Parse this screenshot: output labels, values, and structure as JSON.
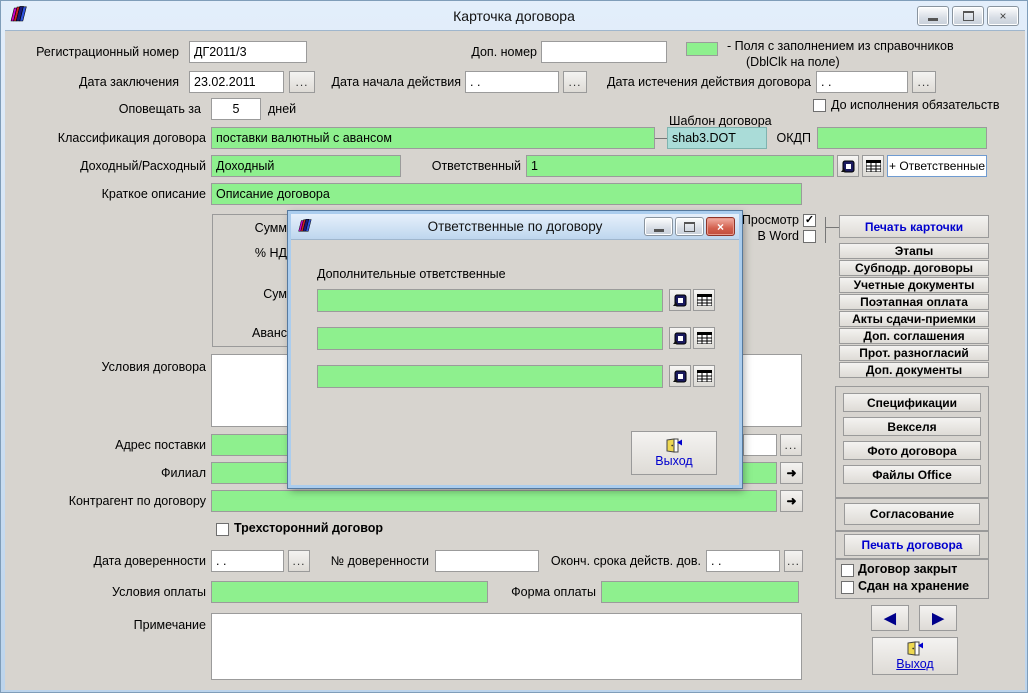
{
  "icons": {
    "close": "×",
    "dots": "...",
    "check": "✓",
    "arrow_right": "➜",
    "nav_prev": "◀",
    "nav_next": "▶",
    "scroll_up": "∧",
    "scroll_down": "∨"
  },
  "window": {
    "title": "Карточка договора"
  },
  "legend": {
    "line1": "- Поля с заполнением из справочников",
    "line2": "(DblClk на поле)"
  },
  "form": {
    "reg_number_label": "Регистрационный номер",
    "reg_number_value": "ДГ2011/3",
    "dop_number_label": "Доп. номер",
    "dop_number_value": "",
    "date_conclusion_label": "Дата заключения",
    "date_conclusion_value": "23.02.2011",
    "date_start_label": "Дата начала действия",
    "date_start_value": ". .",
    "date_expiry_label": "Дата истечения действия договора",
    "date_expiry_value": ". .",
    "notify_label": "Оповещать за",
    "notify_value": "5",
    "notify_suffix": "дней",
    "until_fulfillment_label": "До исполнения обязательств",
    "template_label": "Шаблон договора",
    "template_value": "shab3.DOT",
    "classification_label": "Классификация договора",
    "classification_value": "поставки валютный с авансом",
    "okdp_label": "ОКДП",
    "okdp_value": "",
    "income_label": "Доходный/Расходный",
    "income_value": "Доходный",
    "responsible_label": "Ответственный",
    "responsible_value": "1",
    "add_responsible_button": "+ Ответственные",
    "short_desc_label": "Краткое описание",
    "short_desc_value": "Описание договора",
    "sum_fragment_1": "Сумм",
    "sum_fragment_2": "% НД",
    "sum_fragment_3": "Сум",
    "sum_fragment_4": "Аванс",
    "terms_label": "Условия договора",
    "terms_value": "",
    "address_label": "Адрес поставки",
    "address_value": "",
    "branch_label": "Филиал",
    "branch_value": "",
    "counterparty_label": "Контрагент по договору",
    "counterparty_value": "",
    "trilateral_label": "Трехсторонний договор",
    "poa_date_label": "Дата доверенности",
    "poa_date_value": ". .",
    "poa_number_label": "№ доверенности",
    "poa_number_value": "",
    "poa_end_label": "Оконч. срока действ. дов.",
    "poa_end_value": ". .",
    "payment_terms_label": "Условия оплаты",
    "payment_terms_value": "",
    "payment_form_label": "Форма оплаты",
    "payment_form_value": "",
    "note_label": "Примечание",
    "note_value": ""
  },
  "right_panel": {
    "preview_label": "Просмотр",
    "word_label": "В Word",
    "print_card": "Печать карточки",
    "buttons": [
      "Этапы",
      "Субподр. договоры",
      "Учетные документы",
      "Поэтапная оплата",
      "Акты сдачи-приемки",
      "Доп. соглашения",
      "Прот. разногласий",
      "Доп. документы"
    ],
    "docs_buttons": [
      "Спецификации",
      "Векселя",
      "Фото договора",
      "Файлы Office"
    ],
    "approval_button": "Согласование",
    "print_contract": "Печать договора",
    "closed_label": "Договор закрыт",
    "stored_label": "Сдан на хранение",
    "exit_label": "Выход"
  },
  "dialog": {
    "title": "Ответственные по договору",
    "subtitle": "Дополнительные ответственные",
    "exit_label": "Выход"
  },
  "colors": {
    "field_green": "#8ef08e",
    "field_cyan": "#aadcd8",
    "link_blue": "#0000cd"
  }
}
